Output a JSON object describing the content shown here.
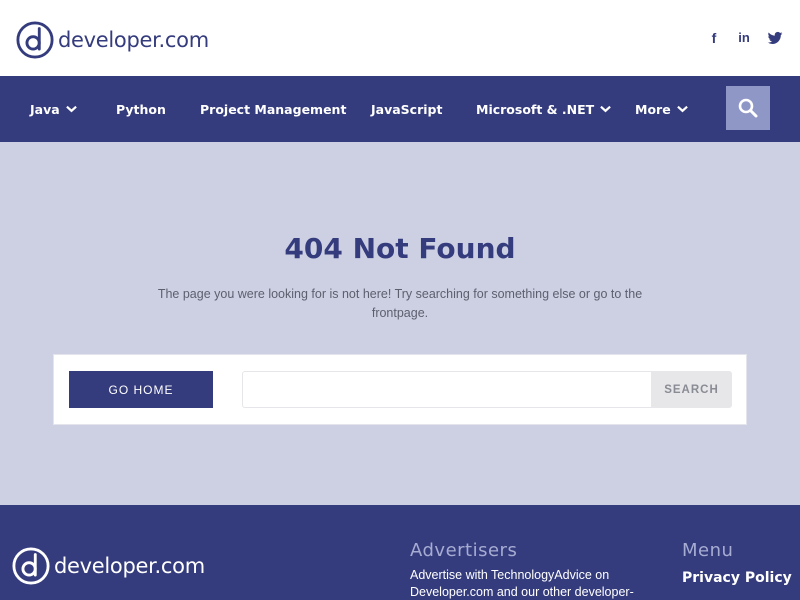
{
  "header": {
    "logo_text": "developer.com",
    "social": [
      {
        "icon": "facebook-icon",
        "glyph": "f"
      },
      {
        "icon": "linkedin-icon",
        "glyph": "in"
      },
      {
        "icon": "twitter-icon",
        "glyph": ""
      }
    ]
  },
  "nav": {
    "items": [
      {
        "label": "Java",
        "has_dropdown": true
      },
      {
        "label": "Python",
        "has_dropdown": false
      },
      {
        "label": "Project Management",
        "has_dropdown": false
      },
      {
        "label": "JavaScript",
        "has_dropdown": false
      },
      {
        "label": "Microsoft & .NET",
        "has_dropdown": true
      },
      {
        "label": "More",
        "has_dropdown": true
      }
    ],
    "search_icon": "search-icon"
  },
  "main": {
    "title": "404 Not Found",
    "message": "The page you were looking for is not here! Try searching for something else or go to the frontpage.",
    "home_button": "GO HOME",
    "search_placeholder": "",
    "search_button": "SEARCH"
  },
  "footer": {
    "logo_text": "developer.com",
    "advertisers_heading": "Advertisers",
    "advertisers_text": "Advertise with TechnologyAdvice on Developer.com and our other developer-",
    "menu_heading": "Menu",
    "menu_link": "Privacy Policy"
  },
  "colors": {
    "brand": "#353c7d",
    "page_bg": "#cdd0e2",
    "search_button_bg": "#8f97c6",
    "footer_heading": "#a6acd2"
  }
}
